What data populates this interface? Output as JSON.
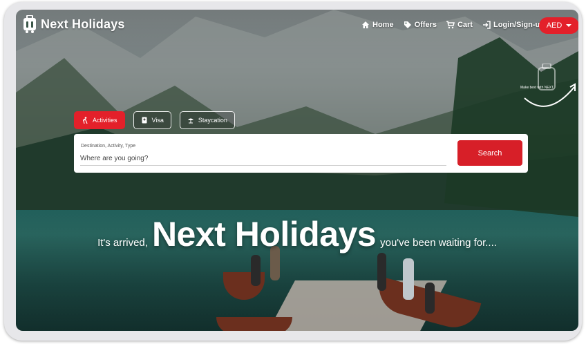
{
  "brand": {
    "name": "Next Holidays"
  },
  "nav": {
    "home": "Home",
    "offers": "Offers",
    "cart": "Cart",
    "login": "Login/Sign-up",
    "currency": "AED"
  },
  "tabs": [
    {
      "label": "Activities",
      "icon": "hiking-icon",
      "active": true
    },
    {
      "label": "Visa",
      "icon": "passport-icon",
      "active": false
    },
    {
      "label": "Staycation",
      "icon": "beach-umbrella-icon",
      "active": false
    }
  ],
  "search": {
    "label": "Destination, Activity, Type",
    "placeholder": "Where are you going?",
    "button": "Search"
  },
  "badge": {
    "text": "Make best with NEXT"
  },
  "hero": {
    "prefix": "It's arrived,",
    "brand": "Next Holidays",
    "suffix": "you've been waiting for...."
  },
  "colors": {
    "accent": "#e3202a",
    "text_on_dark": "#ffffff"
  }
}
